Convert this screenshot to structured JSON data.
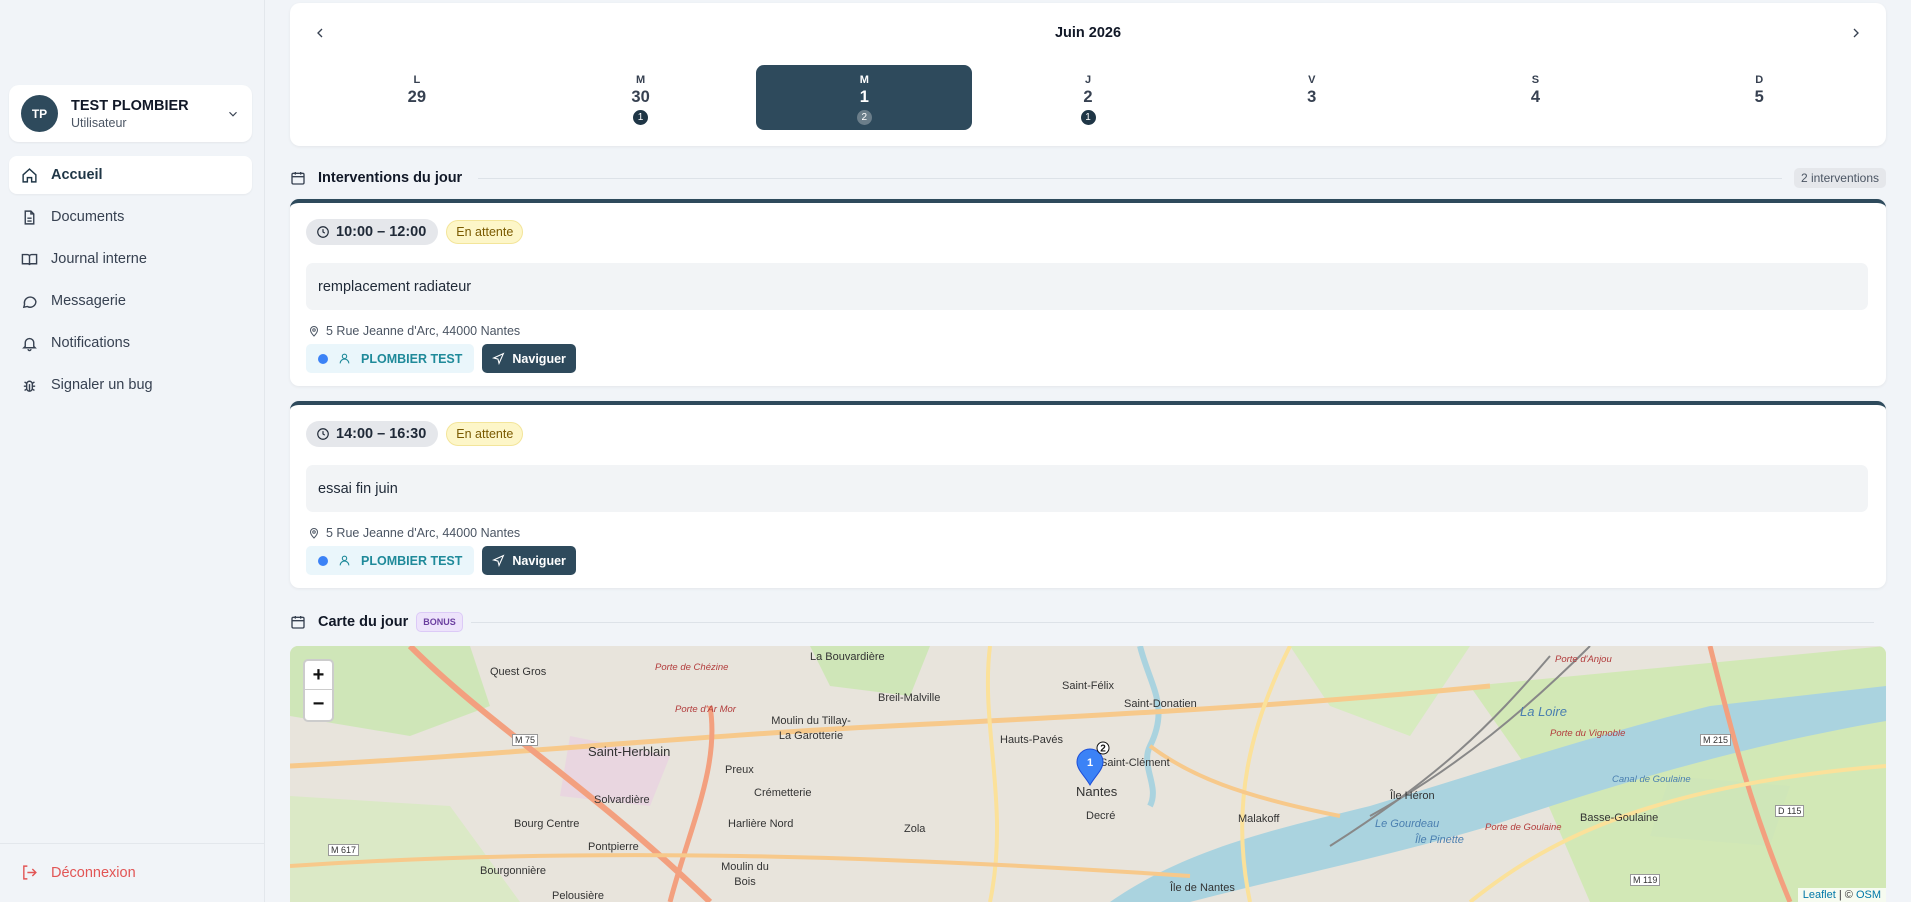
{
  "user": {
    "initials": "TP",
    "name": "TEST PLOMBIER",
    "role": "Utilisateur"
  },
  "nav": [
    {
      "label": "Accueil",
      "icon": "home-icon",
      "active": true
    },
    {
      "label": "Documents",
      "icon": "document-icon"
    },
    {
      "label": "Journal interne",
      "icon": "book-icon"
    },
    {
      "label": "Messagerie",
      "icon": "message-icon"
    },
    {
      "label": "Notifications",
      "icon": "bell-icon"
    },
    {
      "label": "Signaler un bug",
      "icon": "bug-icon"
    }
  ],
  "logout": "Déconnexion",
  "calendar": {
    "month": "Juin 2026",
    "days": [
      {
        "letter": "L",
        "num": "29",
        "count": ""
      },
      {
        "letter": "M",
        "num": "30",
        "count": "1"
      },
      {
        "letter": "M",
        "num": "1",
        "count": "2",
        "selected": true
      },
      {
        "letter": "J",
        "num": "2",
        "count": "1"
      },
      {
        "letter": "V",
        "num": "3",
        "count": ""
      },
      {
        "letter": "S",
        "num": "4",
        "count": ""
      },
      {
        "letter": "D",
        "num": "5",
        "count": ""
      }
    ]
  },
  "interventions_section": {
    "title": "Interventions du jour",
    "count": "2 interventions"
  },
  "interventions": [
    {
      "time": "10:00 – 12:00",
      "status": "En attente",
      "description": "remplacement radiateur",
      "address": "5 Rue Jeanne d'Arc, 44000 Nantes",
      "tech": "PLOMBIER TEST",
      "nav_label": "Naviguer"
    },
    {
      "time": "14:00 – 16:30",
      "status": "En attente",
      "description": "essai fin juin",
      "address": "5 Rue Jeanne d'Arc, 44000 Nantes",
      "tech": "PLOMBIER TEST",
      "nav_label": "Naviguer"
    }
  ],
  "map_section": {
    "title": "Carte du jour",
    "badge": "BONUS"
  },
  "map": {
    "zoom_in": "+",
    "zoom_out": "−",
    "attribution_leaflet": "Leaflet",
    "attribution_sep": " | © ",
    "attribution_osm": "OSM",
    "marker_main": "1",
    "marker_cluster": "2",
    "labels": [
      "Quest Gros",
      "Porte de Chézine",
      "La Bouvardière",
      "Breil-Malville",
      "Saint-Félix",
      "Saint-Donatien",
      "Porte d'Anjou",
      "Porte d'Ar Mor",
      "Moulin du Tillay-La Garotterie",
      "Hauts-Pavés",
      "Saint-Herblain",
      "Preux",
      "Saint-Clément",
      "Nantes",
      "Crémetterie",
      "Solvardière",
      "Bourg Centre",
      "Harlière Nord",
      "Zola",
      "Decré",
      "Malakoff",
      "Pontpierre",
      "Bourgonnière",
      "Moulin du Bois",
      "Pelousière",
      "Île de Nantes",
      "Île Héron",
      "Basse-Goulaine",
      "Porte du Vignoble",
      "La Loire",
      "Île Pinette",
      "Le Gourdeau",
      "M 75",
      "M 617",
      "M 215",
      "D 115",
      "M 119",
      "Porte de Goulaine",
      "Canal de Goulaine"
    ]
  },
  "colors": {
    "primary": "#2e4a5c",
    "danger": "#e25555",
    "pending_bg": "#fdf6c8",
    "tech_text": "#1f8a9a",
    "dot": "#3b82f6"
  }
}
